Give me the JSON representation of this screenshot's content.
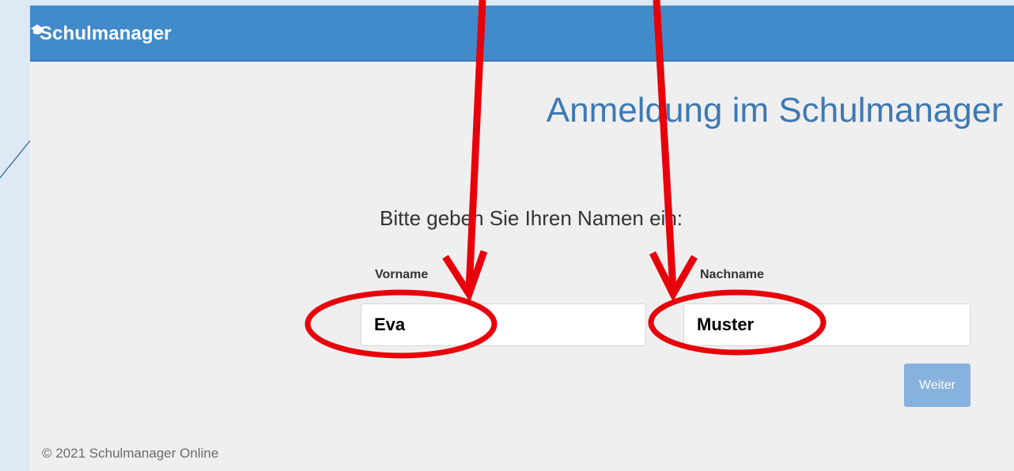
{
  "brand": {
    "name": "Schulmanager",
    "logo_icon": "graduation-cap-icon"
  },
  "page": {
    "title": "Anmeldung im Schulmanager",
    "prompt": "Bitte geben Sie Ihren Namen ein:"
  },
  "form": {
    "first_name": {
      "label": "Vorname",
      "value": "Eva"
    },
    "last_name": {
      "label": "Nachname",
      "value": "Muster"
    },
    "submit_label": "Weiter"
  },
  "footer": {
    "copyright": "© 2021 Schulmanager Online"
  },
  "colors": {
    "navbar": "#428bca",
    "title": "#3d79b4",
    "button": "#86b2dd",
    "annotation": "#e8000b"
  }
}
